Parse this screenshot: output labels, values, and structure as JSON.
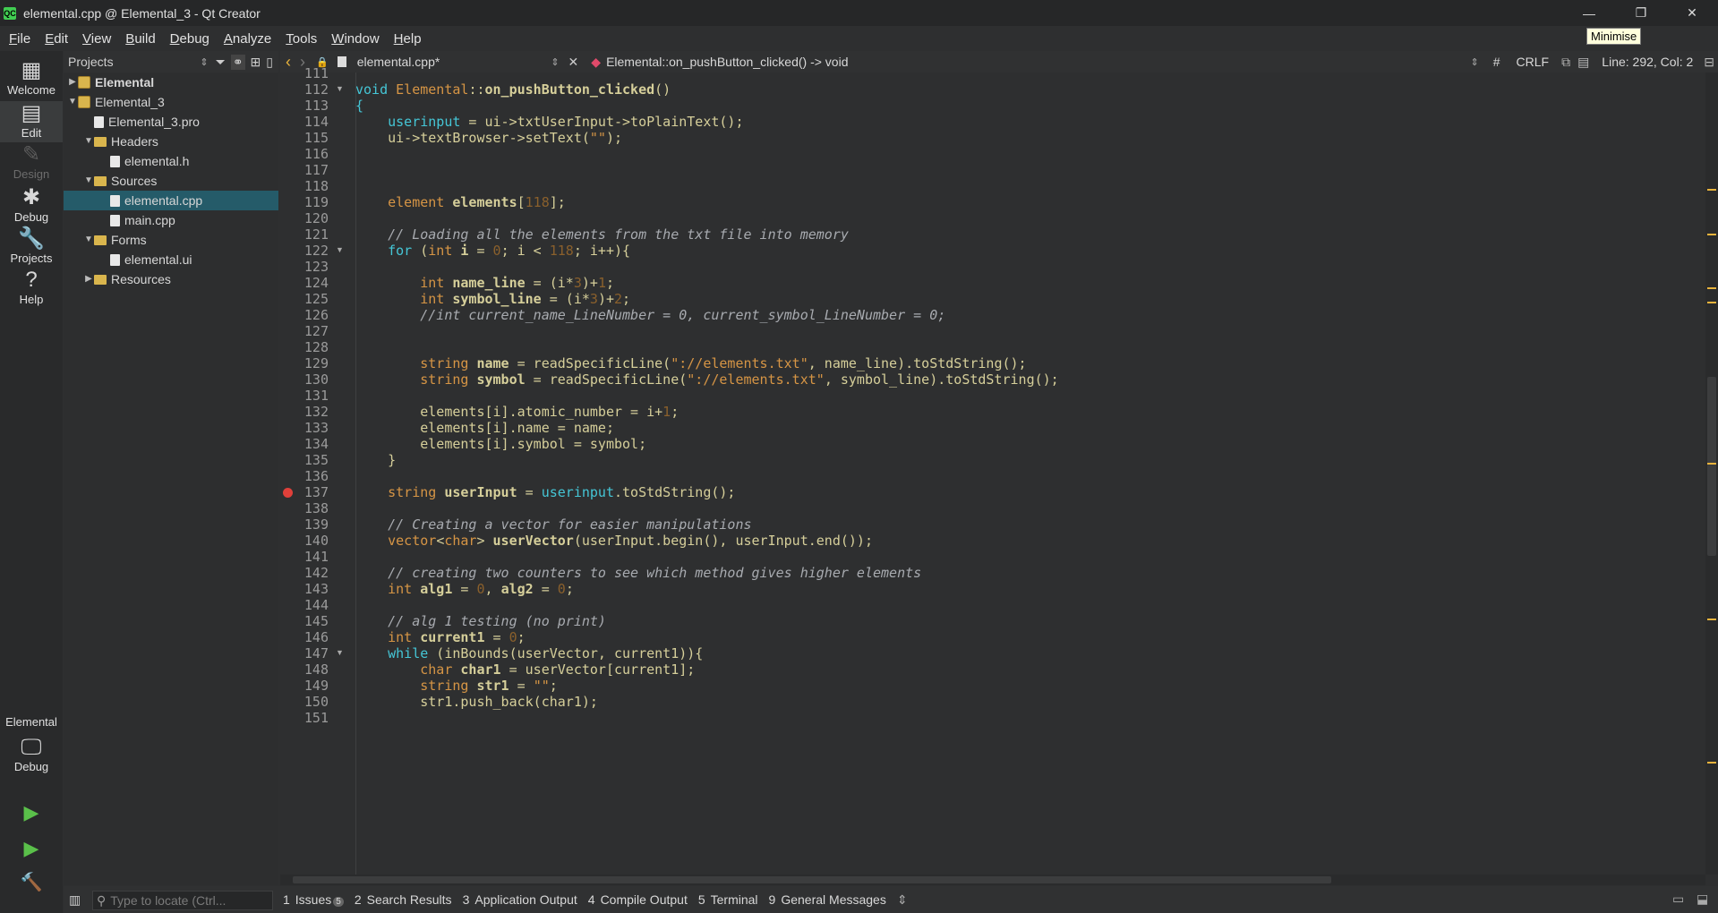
{
  "window": {
    "app_icon_text": "QC",
    "title": "elemental.cpp @ Elemental_3 - Qt Creator",
    "minimize_glyph": "—",
    "restore_glyph": "❐",
    "close_glyph": "✕",
    "tooltip": "Minimise"
  },
  "menubar": {
    "items": [
      {
        "label": "File",
        "mnemonic": "F",
        "rest": "ile"
      },
      {
        "label": "Edit",
        "mnemonic": "E",
        "rest": "dit"
      },
      {
        "label": "View",
        "mnemonic": "V",
        "rest": "iew"
      },
      {
        "label": "Build",
        "mnemonic": "B",
        "rest": "uild"
      },
      {
        "label": "Debug",
        "mnemonic": "D",
        "rest": "ebug"
      },
      {
        "label": "Analyze",
        "mnemonic": "A",
        "rest": "nalyze"
      },
      {
        "label": "Tools",
        "mnemonic": "T",
        "rest": "ools"
      },
      {
        "label": "Window",
        "mnemonic": "W",
        "rest": "indow"
      },
      {
        "label": "Help",
        "mnemonic": "H",
        "rest": "elp"
      }
    ]
  },
  "modebar": {
    "modes": [
      {
        "label": "Welcome",
        "icon": "grid-icon",
        "glyph": "▦",
        "state": "normal"
      },
      {
        "label": "Edit",
        "icon": "document-icon",
        "glyph": "▤",
        "state": "active"
      },
      {
        "label": "Design",
        "icon": "pencil-icon",
        "glyph": "✎",
        "state": "disabled"
      },
      {
        "label": "Debug",
        "icon": "bug-icon",
        "glyph": "✱",
        "state": "normal"
      },
      {
        "label": "Projects",
        "icon": "wrench-icon",
        "glyph": "🔧",
        "state": "normal"
      },
      {
        "label": "Help",
        "icon": "help-icon",
        "glyph": "?",
        "state": "normal"
      }
    ],
    "kit_label": "Elemental",
    "kit_mode_label": "Debug",
    "run_glyph": "▶",
    "debug_run_glyph": "▶",
    "build_glyph": "🔨"
  },
  "projects": {
    "header": "Projects",
    "tree": [
      {
        "label": "Elemental",
        "kind": "project",
        "expanded": false,
        "bold": true
      },
      {
        "label": "Elemental_3",
        "kind": "project",
        "expanded": true,
        "bold": false
      },
      {
        "label": "Elemental_3.pro",
        "kind": "file"
      },
      {
        "label": "Headers",
        "kind": "folder",
        "expanded": true
      },
      {
        "label": "elemental.h",
        "kind": "file"
      },
      {
        "label": "Sources",
        "kind": "folder",
        "expanded": true
      },
      {
        "label": "elemental.cpp",
        "kind": "file",
        "selected": true
      },
      {
        "label": "main.cpp",
        "kind": "file"
      },
      {
        "label": "Forms",
        "kind": "folder",
        "expanded": true
      },
      {
        "label": "elemental.ui",
        "kind": "file"
      },
      {
        "label": "Resources",
        "kind": "folder",
        "expanded": false
      }
    ]
  },
  "editor": {
    "toolbar": {
      "back_glyph": "‹",
      "forward_glyph": "›",
      "file_tab": "elemental.cpp*",
      "close_glyph": "✕",
      "symbol": "Elemental::on_pushButton_clicked() -> void",
      "hash": "#",
      "line_ending": "CRLF",
      "cursor": "Line: 292, Col: 2"
    },
    "breakpoint_line": 137,
    "fold_lines": [
      112,
      122,
      147
    ],
    "lines": [
      {
        "n": "111",
        "html": ""
      },
      {
        "n": "112",
        "html": "<span class='kw'>void</span> <span class='ty'>Elemental</span>::<span class='bold'>on_pushButton_clicked</span>()"
      },
      {
        "n": "113",
        "html": "<span class='kw'>{</span>"
      },
      {
        "n": "114",
        "html": "    <span class='kw'>userinput</span> = ui-&gt;txtUserInput-&gt;toPlainText();"
      },
      {
        "n": "115",
        "html": "    ui-&gt;textBrowser-&gt;setText(<span class='str'>\"\"</span>);"
      },
      {
        "n": "116",
        "html": ""
      },
      {
        "n": "117",
        "html": ""
      },
      {
        "n": "118",
        "html": ""
      },
      {
        "n": "119",
        "html": "    <span class='ty'>element</span> <span class='bold'>elements</span>[<span class='num'>118</span>];"
      },
      {
        "n": "120",
        "html": ""
      },
      {
        "n": "121",
        "html": "    <span class='com'>// Loading all the elements from the txt file into memory</span>"
      },
      {
        "n": "122",
        "html": "    <span class='kw'>for</span> (<span class='ty'>int</span> <span class='bold'>i</span> = <span class='num'>0</span>; i &lt; <span class='num'>118</span>; i++){"
      },
      {
        "n": "123",
        "html": ""
      },
      {
        "n": "124",
        "html": "        <span class='ty'>int</span> <span class='bold'>name_line</span> = (i*<span class='num'>3</span>)+<span class='num'>1</span>;"
      },
      {
        "n": "125",
        "html": "        <span class='ty'>int</span> <span class='bold'>symbol_line</span> = (i*<span class='num'>3</span>)+<span class='num'>2</span>;"
      },
      {
        "n": "126",
        "html": "        <span class='com'>//int current_name_LineNumber = 0, current_symbol_LineNumber = 0;</span>"
      },
      {
        "n": "127",
        "html": ""
      },
      {
        "n": "128",
        "html": ""
      },
      {
        "n": "129",
        "html": "        <span class='ty'>string</span> <span class='bold'>name</span> = readSpecificLine(<span class='str'>\"://elements.txt\"</span>, name_line).toStdString();"
      },
      {
        "n": "130",
        "html": "        <span class='ty'>string</span> <span class='bold'>symbol</span> = readSpecificLine(<span class='str'>\"://elements.txt\"</span>, symbol_line).toStdString();"
      },
      {
        "n": "131",
        "html": ""
      },
      {
        "n": "132",
        "html": "        elements[i].atomic_number = i+<span class='num'>1</span>;"
      },
      {
        "n": "133",
        "html": "        elements[i].name = name;"
      },
      {
        "n": "134",
        "html": "        elements[i].symbol = symbol;"
      },
      {
        "n": "135",
        "html": "    }"
      },
      {
        "n": "136",
        "html": ""
      },
      {
        "n": "137",
        "html": "    <span class='ty'>string</span> <span class='bold'>userInput</span> = <span class='kw'>userinput</span>.toStdString();"
      },
      {
        "n": "138",
        "html": ""
      },
      {
        "n": "139",
        "html": "    <span class='com'>// Creating a vector for easier manipulations</span>"
      },
      {
        "n": "140",
        "html": "    <span class='ty'>vector</span>&lt;<span class='ty'>char</span>&gt; <span class='bold'>userVector</span>(userInput.begin(), userInput.end());"
      },
      {
        "n": "141",
        "html": ""
      },
      {
        "n": "142",
        "html": "    <span class='com'>// creating two counters to see which method gives higher elements</span>"
      },
      {
        "n": "143",
        "html": "    <span class='ty'>int</span> <span class='bold'>alg1</span> = <span class='num'>0</span>, <span class='bold'>alg2</span> = <span class='num'>0</span>;"
      },
      {
        "n": "144",
        "html": ""
      },
      {
        "n": "145",
        "html": "    <span class='com'>// alg 1 testing (no print)</span>"
      },
      {
        "n": "146",
        "html": "    <span class='ty'>int</span> <span class='bold'>current1</span> = <span class='num'>0</span>;"
      },
      {
        "n": "147",
        "html": "    <span class='kw'>while</span> (inBounds(userVector, current1)){"
      },
      {
        "n": "148",
        "html": "        <span class='ty'>char</span> <span class='bold'>char1</span> = userVector[current1];"
      },
      {
        "n": "149",
        "html": "        <span class='ty'>string</span> <span class='bold'>str1</span> = <span class='str'>\"\"</span>;"
      },
      {
        "n": "150",
        "html": "        str1.push_back(char1);"
      },
      {
        "n": "151",
        "html": ""
      }
    ]
  },
  "bottom": {
    "locator_placeholder": "Type to locate (Ctrl...",
    "tabs": [
      {
        "num": "1",
        "label": "Issues",
        "badge": "5"
      },
      {
        "num": "2",
        "label": "Search Results"
      },
      {
        "num": "3",
        "label": "Application Output"
      },
      {
        "num": "4",
        "label": "Compile Output"
      },
      {
        "num": "5",
        "label": "Terminal"
      },
      {
        "num": "9",
        "label": "General Messages"
      }
    ],
    "more_glyph": "⇕"
  },
  "colors": {
    "background": "#2e2f30",
    "selection": "#255b69",
    "keyword": "#45c6d6",
    "type": "#d69545",
    "breakpoint": "#e0403a"
  }
}
